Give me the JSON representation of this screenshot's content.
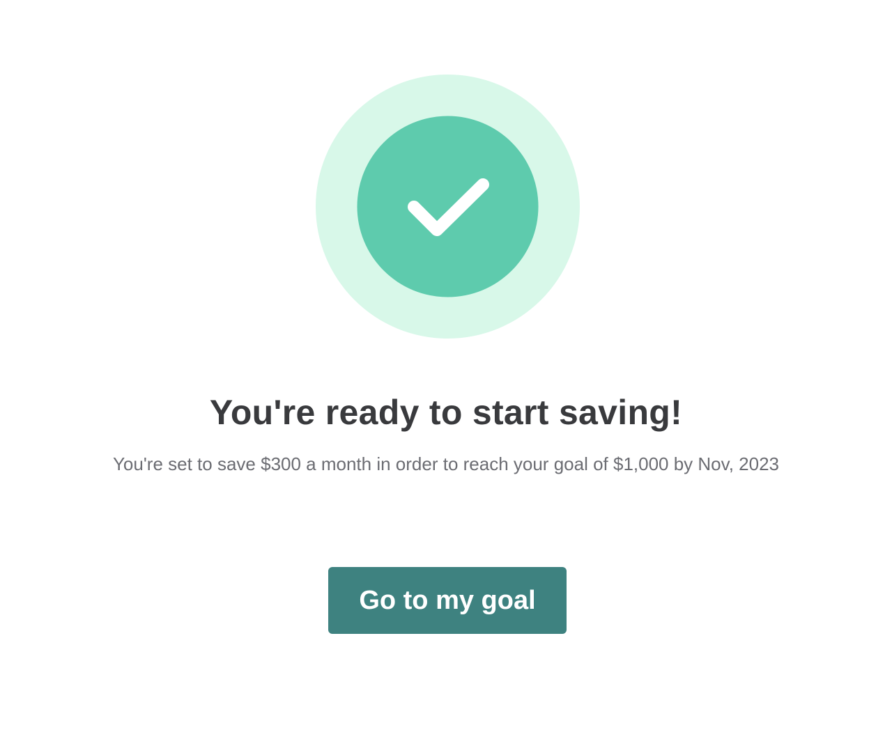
{
  "success": {
    "icon": "checkmark-icon",
    "outer_ring_color": "#d8f8e9",
    "inner_circle_color": "#5ecbad",
    "check_color": "#ffffff"
  },
  "headline": "You're ready to start saving!",
  "subtext": "You're set to save $300 a month in order to reach your goal of $1,000 by Nov, 2023",
  "cta": {
    "label": "Go to my goal",
    "color": "#3e8280"
  }
}
